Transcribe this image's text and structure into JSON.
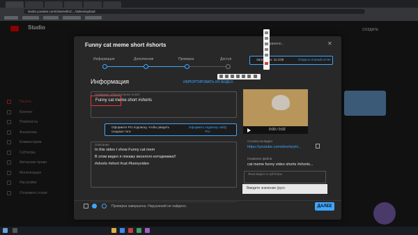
{
  "browser": {
    "url": "studio.youtube.com/channel/UC.../videos/upload"
  },
  "studio": {
    "logo": "Studio",
    "create_label": "СОЗДАТЬ",
    "sidebar": [
      {
        "label": "Панель"
      },
      {
        "label": "Контент"
      },
      {
        "label": "Плейлисты"
      },
      {
        "label": "Аналитика"
      },
      {
        "label": "Комментарии"
      },
      {
        "label": "Субтитры"
      },
      {
        "label": "Авторские права"
      },
      {
        "label": "Монетизация"
      },
      {
        "label": "Настройки"
      },
      {
        "label": "Отправить отзыв"
      }
    ]
  },
  "dialog": {
    "title": "Funny cat meme short #shorts",
    "saved": "Сохранено...",
    "steps": [
      {
        "label": "Информация"
      },
      {
        "label": "Дополнения"
      },
      {
        "label": "Проверка"
      },
      {
        "label": "Доступ"
      }
    ],
    "section_title": "Информация",
    "import_link": "ИМПОРТИРОВАТЬ ИЗ ВИДЕО",
    "title_field": {
      "label": "Название (обязательное поле)",
      "value": "Funny cat meme short #shorts"
    },
    "promo": {
      "text": "Оформите Pro подписку, чтобы увидеть сходные тэги",
      "link": "Оформить подписку vidIQ Pro"
    },
    "description": {
      "label": "Описание",
      "lines": [
        "In this video I show Funny cat mem",
        "В этом видео я покажу веселого котодемика!!",
        "#shorts #short #cat #funnyvideo"
      ]
    },
    "upload": {
      "text": "Загружено: 11:1/36",
      "link": "Открыть полный отчет"
    },
    "video": {
      "time": "0:00 / 0:02"
    },
    "link_label": "Ссылка на видео",
    "link_value": "https://youtube.com/shorts/yH...",
    "file_label": "Название файла",
    "file_value": "cat meme funny video shorts #shorts...",
    "lang_label": "Язык видео и субтитры",
    "select_text": "Введите значение (русс",
    "footer_text": "Проверка завершена. Нарушений не найдено.",
    "next_label": "ДАЛЕЕ"
  }
}
